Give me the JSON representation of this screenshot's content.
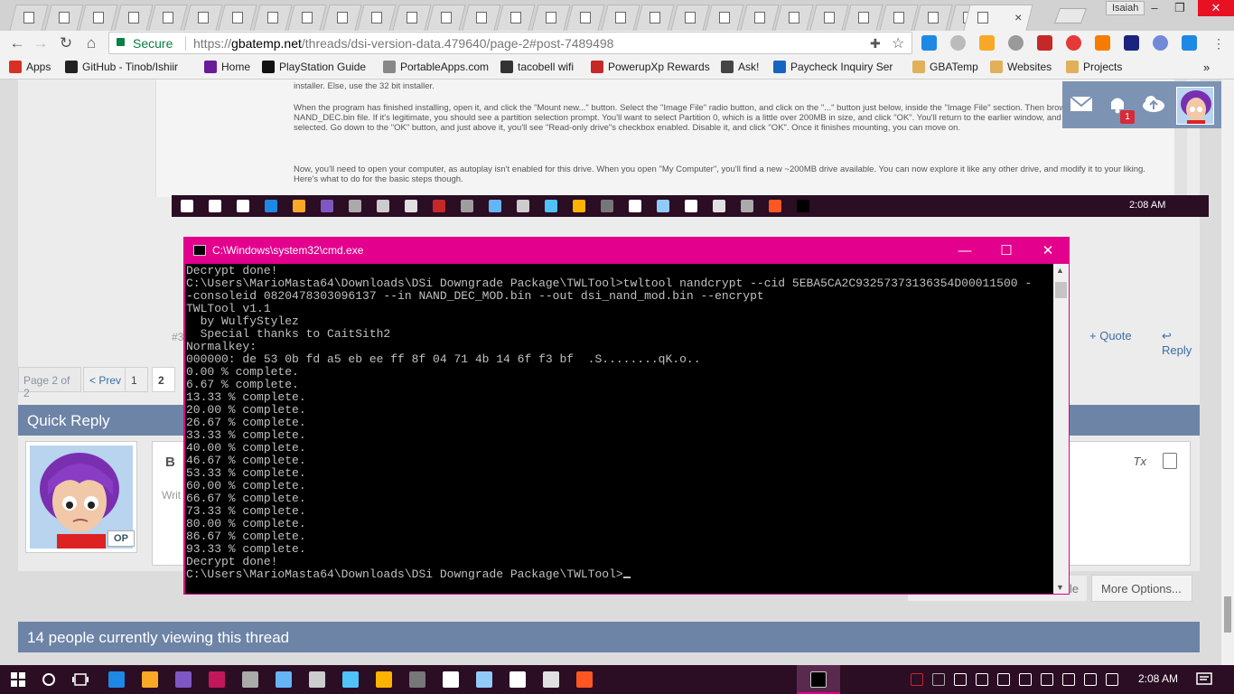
{
  "browser": {
    "tab_count_visible": 28,
    "active_tab_title": "",
    "user_label": "Isaiah",
    "secure_label": "Secure",
    "url_scheme": "https://",
    "url_host": "gbatemp.net",
    "url_path": "/threads/dsi-version-data.479640/page-2#post-7489498",
    "bookmarks": [
      {
        "label": "Apps",
        "icon_color": "#d93025"
      },
      {
        "label": "GitHub - Tinob/Ishiir",
        "icon_color": "#222222"
      },
      {
        "label": "Home",
        "icon_color": "#6a1b9a"
      },
      {
        "label": "PlayStation Guide",
        "icon_color": "#111111"
      },
      {
        "label": "PortableApps.com",
        "icon_color": "#888888"
      },
      {
        "label": "tacobell wifi",
        "icon_color": "#333333"
      },
      {
        "label": "PowerupXp Rewards",
        "icon_color": "#c62828"
      },
      {
        "label": "Ask!",
        "icon_color": "#444444"
      },
      {
        "label": "Paycheck Inquiry Ser",
        "icon_color": "#1565c0"
      },
      {
        "label": "GBATemp",
        "icon_color": "#e0b05a"
      },
      {
        "label": "Websites",
        "icon_color": "#e0b05a"
      },
      {
        "label": "Projects",
        "icon_color": "#e0b05a"
      }
    ],
    "more_bookmarks": "»"
  },
  "post": {
    "line_installer": "installer. Else, use the 32 bit installer.",
    "paragraph1": "When the program has finished installing, open it, and click the \"Mount new...\" button. Select the \"Image File\" radio button, and click on the \"...\" button just below, inside the \"Image File\" section. Then browse to, and open, your NAND_DEC.bin file. If it's legitimate, you should see a partition selection prompt. You'll want to select Partition 0, which is a little over 200MB in size, and click \"OK\". You'll return to the earlier window, and now your NAND will be selected. Go down to the \"OK\" button, and just above it, you'll see \"Read-only drive\"s checkbox enabled. Disable it, and click \"OK\". Once it finishes mounting, you can move on.",
    "paragraph2": "Now, you'll need to open your computer, as autoplay isn't enabled for this drive. When you open \"My Computer\", you'll find a new ~200MB drive available. You can now explore it like any other drive, and modify it to your liking. Here's what to do for the basic steps though.",
    "post_number": "#33",
    "quote_label": "+ Quote",
    "reply_label": "Reply",
    "inner_time": "2:08 AM"
  },
  "pagination": {
    "label": "Page 2 of 2",
    "prev": "< Prev",
    "pages": [
      "1",
      "2"
    ]
  },
  "quick_reply": {
    "title": "Quick Reply",
    "op_badge": "OP",
    "bold": "B",
    "placeholder": "Writ",
    "clear_format": "Tx",
    "more_options": "More Options...",
    "ghost_button": "ile"
  },
  "viewers": "14 people currently viewing this thread",
  "notification_count": "1",
  "cmd": {
    "title": "C:\\Windows\\system32\\cmd.exe",
    "lines": [
      "Decrypt done!",
      "C:\\Users\\MarioMasta64\\Downloads\\DSi Downgrade Package\\TWLTool>twltool nandcrypt --cid 5EBA5CA2C93257373136354D00011500 -",
      "-consoleid 0820478303096137 --in NAND_DEC_MOD.bin --out dsi_nand_mod.bin --encrypt",
      "TWLTool v1.1",
      "  by WulfyStylez",
      "  Special thanks to CaitSith2",
      "",
      "Normalkey:",
      "000000: de 53 0b fd a5 eb ee ff 8f 04 71 4b 14 6f f3 bf  .S........qK.o..",
      "0.00 % complete.",
      "6.67 % complete.",
      "13.33 % complete.",
      "20.00 % complete.",
      "26.67 % complete.",
      "33.33 % complete.",
      "40.00 % complete.",
      "46.67 % complete.",
      "53.33 % complete.",
      "60.00 % complete.",
      "66.67 % complete.",
      "73.33 % complete.",
      "80.00 % complete.",
      "86.67 % complete.",
      "93.33 % complete.",
      "Decrypt done!",
      "C:\\Users\\MarioMasta64\\Downloads\\DSi Downgrade Package\\TWLTool>"
    ]
  },
  "taskbar": {
    "time": "2:08 AM",
    "accent": "#e3008c",
    "background": "#2b0d24"
  }
}
